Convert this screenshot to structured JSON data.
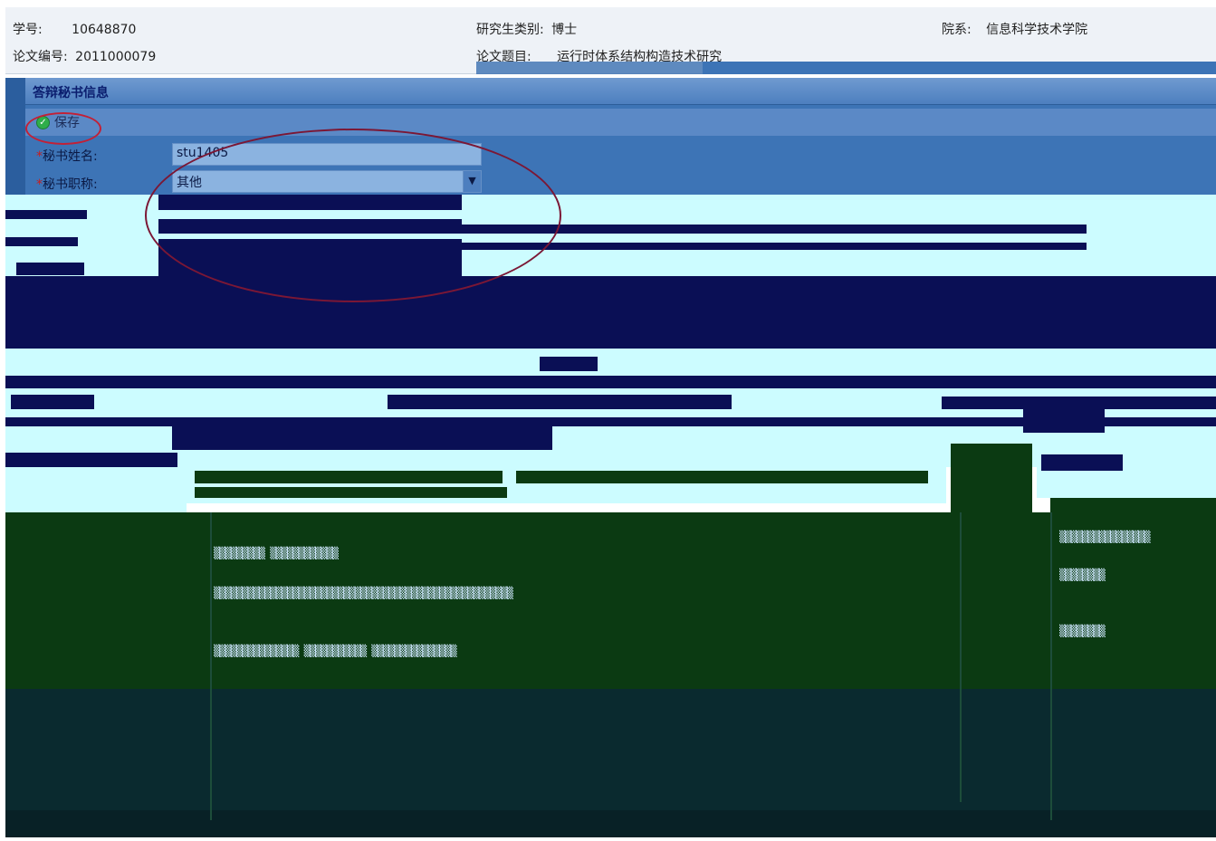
{
  "header": {
    "student_id_label": "学号:",
    "student_id_value": "10648870",
    "category_label": "研究生类别:",
    "category_value": "博士",
    "department_label": "院系:",
    "department_value": "信息科学技术学院",
    "thesis_no_label": "论文编号:",
    "thesis_no_value": "2011000079",
    "thesis_title_label": "论文题目:",
    "thesis_title_value": "运行时体系结构构造技术研究"
  },
  "panel": {
    "title": "答辩秘书信息",
    "save_label": "保存",
    "secretary_name_label": "秘书姓名:",
    "secretary_name_value": "stu1405",
    "secretary_title_label": "秘书职称:",
    "secretary_title_value": "其他",
    "required_mark": "*"
  },
  "colors": {
    "navy": "#0a0f55",
    "cyan": "#ccfcff",
    "dark_green": "#0b3a12",
    "panel_blue": "#3d74b6",
    "ellipse_red": "#c32036"
  }
}
